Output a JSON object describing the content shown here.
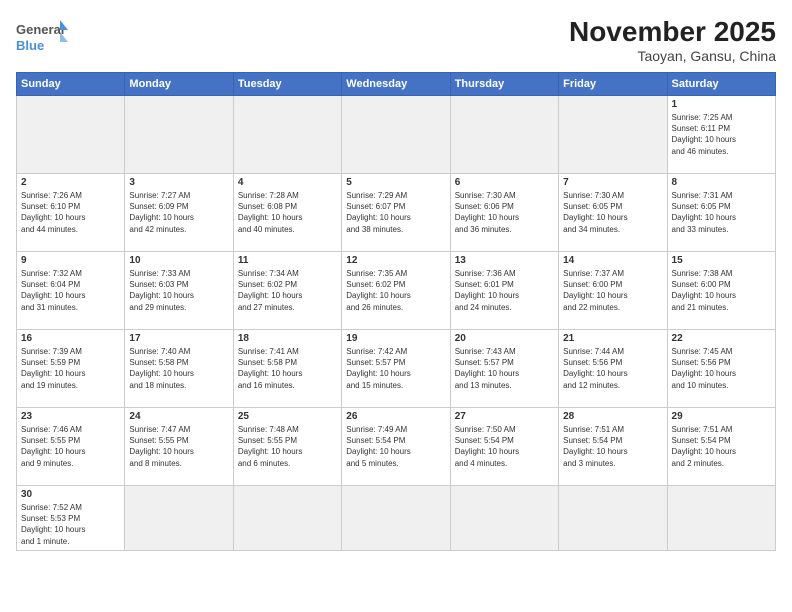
{
  "header": {
    "logo_general": "General",
    "logo_blue": "Blue",
    "title": "November 2025",
    "subtitle": "Taoyan, Gansu, China"
  },
  "days_of_week": [
    "Sunday",
    "Monday",
    "Tuesday",
    "Wednesday",
    "Thursday",
    "Friday",
    "Saturday"
  ],
  "weeks": [
    [
      {
        "num": "",
        "info": "",
        "empty": true
      },
      {
        "num": "",
        "info": "",
        "empty": true
      },
      {
        "num": "",
        "info": "",
        "empty": true
      },
      {
        "num": "",
        "info": "",
        "empty": true
      },
      {
        "num": "",
        "info": "",
        "empty": true
      },
      {
        "num": "",
        "info": "",
        "empty": true
      },
      {
        "num": "1",
        "info": "Sunrise: 7:25 AM\nSunset: 6:11 PM\nDaylight: 10 hours\nand 46 minutes.",
        "empty": false
      }
    ],
    [
      {
        "num": "2",
        "info": "Sunrise: 7:26 AM\nSunset: 6:10 PM\nDaylight: 10 hours\nand 44 minutes.",
        "empty": false
      },
      {
        "num": "3",
        "info": "Sunrise: 7:27 AM\nSunset: 6:09 PM\nDaylight: 10 hours\nand 42 minutes.",
        "empty": false
      },
      {
        "num": "4",
        "info": "Sunrise: 7:28 AM\nSunset: 6:08 PM\nDaylight: 10 hours\nand 40 minutes.",
        "empty": false
      },
      {
        "num": "5",
        "info": "Sunrise: 7:29 AM\nSunset: 6:07 PM\nDaylight: 10 hours\nand 38 minutes.",
        "empty": false
      },
      {
        "num": "6",
        "info": "Sunrise: 7:30 AM\nSunset: 6:06 PM\nDaylight: 10 hours\nand 36 minutes.",
        "empty": false
      },
      {
        "num": "7",
        "info": "Sunrise: 7:30 AM\nSunset: 6:05 PM\nDaylight: 10 hours\nand 34 minutes.",
        "empty": false
      },
      {
        "num": "8",
        "info": "Sunrise: 7:31 AM\nSunset: 6:05 PM\nDaylight: 10 hours\nand 33 minutes.",
        "empty": false
      }
    ],
    [
      {
        "num": "9",
        "info": "Sunrise: 7:32 AM\nSunset: 6:04 PM\nDaylight: 10 hours\nand 31 minutes.",
        "empty": false
      },
      {
        "num": "10",
        "info": "Sunrise: 7:33 AM\nSunset: 6:03 PM\nDaylight: 10 hours\nand 29 minutes.",
        "empty": false
      },
      {
        "num": "11",
        "info": "Sunrise: 7:34 AM\nSunset: 6:02 PM\nDaylight: 10 hours\nand 27 minutes.",
        "empty": false
      },
      {
        "num": "12",
        "info": "Sunrise: 7:35 AM\nSunset: 6:02 PM\nDaylight: 10 hours\nand 26 minutes.",
        "empty": false
      },
      {
        "num": "13",
        "info": "Sunrise: 7:36 AM\nSunset: 6:01 PM\nDaylight: 10 hours\nand 24 minutes.",
        "empty": false
      },
      {
        "num": "14",
        "info": "Sunrise: 7:37 AM\nSunset: 6:00 PM\nDaylight: 10 hours\nand 22 minutes.",
        "empty": false
      },
      {
        "num": "15",
        "info": "Sunrise: 7:38 AM\nSunset: 6:00 PM\nDaylight: 10 hours\nand 21 minutes.",
        "empty": false
      }
    ],
    [
      {
        "num": "16",
        "info": "Sunrise: 7:39 AM\nSunset: 5:59 PM\nDaylight: 10 hours\nand 19 minutes.",
        "empty": false
      },
      {
        "num": "17",
        "info": "Sunrise: 7:40 AM\nSunset: 5:58 PM\nDaylight: 10 hours\nand 18 minutes.",
        "empty": false
      },
      {
        "num": "18",
        "info": "Sunrise: 7:41 AM\nSunset: 5:58 PM\nDaylight: 10 hours\nand 16 minutes.",
        "empty": false
      },
      {
        "num": "19",
        "info": "Sunrise: 7:42 AM\nSunset: 5:57 PM\nDaylight: 10 hours\nand 15 minutes.",
        "empty": false
      },
      {
        "num": "20",
        "info": "Sunrise: 7:43 AM\nSunset: 5:57 PM\nDaylight: 10 hours\nand 13 minutes.",
        "empty": false
      },
      {
        "num": "21",
        "info": "Sunrise: 7:44 AM\nSunset: 5:56 PM\nDaylight: 10 hours\nand 12 minutes.",
        "empty": false
      },
      {
        "num": "22",
        "info": "Sunrise: 7:45 AM\nSunset: 5:56 PM\nDaylight: 10 hours\nand 10 minutes.",
        "empty": false
      }
    ],
    [
      {
        "num": "23",
        "info": "Sunrise: 7:46 AM\nSunset: 5:55 PM\nDaylight: 10 hours\nand 9 minutes.",
        "empty": false
      },
      {
        "num": "24",
        "info": "Sunrise: 7:47 AM\nSunset: 5:55 PM\nDaylight: 10 hours\nand 8 minutes.",
        "empty": false
      },
      {
        "num": "25",
        "info": "Sunrise: 7:48 AM\nSunset: 5:55 PM\nDaylight: 10 hours\nand 6 minutes.",
        "empty": false
      },
      {
        "num": "26",
        "info": "Sunrise: 7:49 AM\nSunset: 5:54 PM\nDaylight: 10 hours\nand 5 minutes.",
        "empty": false
      },
      {
        "num": "27",
        "info": "Sunrise: 7:50 AM\nSunset: 5:54 PM\nDaylight: 10 hours\nand 4 minutes.",
        "empty": false
      },
      {
        "num": "28",
        "info": "Sunrise: 7:51 AM\nSunset: 5:54 PM\nDaylight: 10 hours\nand 3 minutes.",
        "empty": false
      },
      {
        "num": "29",
        "info": "Sunrise: 7:51 AM\nSunset: 5:54 PM\nDaylight: 10 hours\nand 2 minutes.",
        "empty": false
      }
    ],
    [
      {
        "num": "30",
        "info": "Sunrise: 7:52 AM\nSunset: 5:53 PM\nDaylight: 10 hours\nand 1 minute.",
        "empty": false
      },
      {
        "num": "",
        "info": "",
        "empty": true
      },
      {
        "num": "",
        "info": "",
        "empty": true
      },
      {
        "num": "",
        "info": "",
        "empty": true
      },
      {
        "num": "",
        "info": "",
        "empty": true
      },
      {
        "num": "",
        "info": "",
        "empty": true
      },
      {
        "num": "",
        "info": "",
        "empty": true
      }
    ]
  ]
}
